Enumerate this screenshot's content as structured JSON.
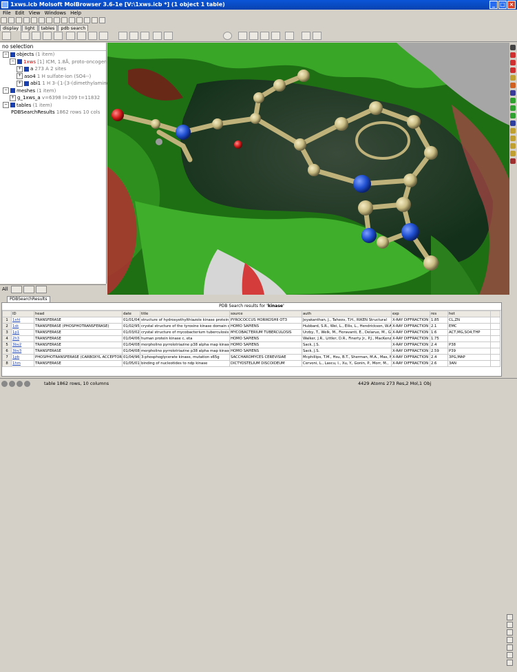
{
  "window": {
    "title": "1xws.icb Molsoft MolBrowser 3.6-1e  [V:\\1xws.icb *]  (1 object 1 table)"
  },
  "menu": [
    "File",
    "Edit",
    "View",
    "Windows",
    "Help"
  ],
  "left_tabs": [
    "display",
    "light",
    "tables",
    "pdb search"
  ],
  "object_panel": {
    "header": "no selection",
    "tree": [
      {
        "name": "objects",
        "info": "(1 item)"
      },
      {
        "name": "1xws",
        "info": "[1] ICM, 1.8Å, proto-oncogene"
      },
      {
        "name": "a",
        "info": "273 A  2 sites"
      },
      {
        "name": "aso4",
        "info": "1 H   sulfate-ion (SO4--)"
      },
      {
        "name": "abi1",
        "info": "1 H   3-{1-[3-(dimethylamino"
      },
      {
        "name": "meshes",
        "info": "(1 item)"
      },
      {
        "name": "g_1xws_a",
        "info": "v=6398 l=209 t=11832"
      },
      {
        "name": "tables",
        "info": "(1 item)"
      },
      {
        "name": "PDBSearchResults",
        "info": "1862 rows 10 cols"
      }
    ],
    "bottom_tab": "All"
  },
  "table_panel": {
    "tab": "PDBSearchResults",
    "title_prefix": "PDB Search results for",
    "query": "'kinase'",
    "columns": [
      "ID",
      "head",
      "date",
      "title",
      "source",
      "auth",
      "exp",
      "res",
      "het"
    ],
    "rows": [
      [
        "1",
        "1xhl",
        "TRANSFERASE",
        "01/01/04",
        "structure of hydroxyethylthiazole kinase protein from",
        "PYROCOCCUS HORIKOSHII OT3",
        "Jeyakanthan, J., Taheov, T.H., RIKEN Structural",
        "X-RAY DIFFRACTION",
        "1.85",
        "CL,ZN"
      ],
      [
        "2",
        "1sk",
        "TRANSFERASE (PHOSPHOTRANSFERASE)",
        "01/02/95",
        "crystal structure of the tyrosine kinase domain of the",
        "HOMO SAPIENS",
        "Hubbard, S.R., Wei, L., Ellis, L., Hendrickson, W.A.",
        "X-RAY DIFFRACTION",
        "2.1",
        "EMC"
      ],
      [
        "3",
        "1p1",
        "TRANSFERASE",
        "01/03/02",
        "crystal structure of mycobacterium tuberculosis thymidylate",
        "MYCOBACTERIUM TUBERCULOSIS",
        "Urzby, T., Welk, M., Fioravanti, E., Delarue, M., Goeldner,",
        "X-RAY DIFFRACTION",
        "1.6",
        "ACT,MG,SO4,THP"
      ],
      [
        "4",
        "2h3",
        "TRANSFERASE",
        "01/04/06",
        "human protein kinase c, eta",
        "HOMO SAPIENS",
        "Walker, J.R., Littler, D.R., Finerty Jr., P.J., MacKenzie, F.,",
        "X-RAY DIFFRACTION",
        "1.75",
        ""
      ],
      [
        "5",
        "3bv2",
        "TRANSFERASE",
        "01/04/08",
        "morpholino pyrrolotriazine p38 alpha map kinase inhibitor",
        "HOMO SAPIENS",
        "Sack, J.S.",
        "X-RAY DIFFRACTION",
        "2.4",
        "P38"
      ],
      [
        "6",
        "3bv3",
        "TRANSFERASE",
        "01/04/08",
        "morpholino pyrrolotriazine p38 alpha map kinase inhibitor",
        "HOMO SAPIENS",
        "Sack, J.S.",
        "X-RAY DIFFRACTION",
        "2.59",
        "P39"
      ],
      [
        "7",
        "1pb",
        "PHOSPHOTRANSFERASE (CARBOXYL ACCEPTOR)",
        "01/04/96",
        "3-phosphoglycerate kinase, mutation s65g",
        "SACCHAROMYCES CEREVISIAE",
        "Mcphillips, T.M., Hsu, B.T., Sherman, M.A., Mas, M.T.,",
        "X-RAY DIFFRACTION",
        "2.4",
        "3PG,MAP"
      ],
      [
        "8",
        "1hm",
        "TRANSFERASE",
        "01/05/01",
        "binding of nucleotides to ndp kinase",
        "DICTYOSTELIUM DISCOIDEUM",
        "Cervoni, L., Lascu, I., Xu, Y., Gonin, P., Morr, M.,",
        "X-RAY DIFFRACTION",
        "2.6",
        "3AN"
      ]
    ]
  },
  "status": {
    "left": "table 1862 rows, 10 columns",
    "right": "4429 Atoms 273 Res,2 Mol,1 Obj"
  },
  "colors": {
    "titlebar": "#0842b0",
    "link": "#1a3fae",
    "surface_green": "#2f9a20",
    "ligand_carbon": "#d1c48a",
    "nitrogen": "#1f4fd0",
    "oxygen": "#d41c1c"
  }
}
